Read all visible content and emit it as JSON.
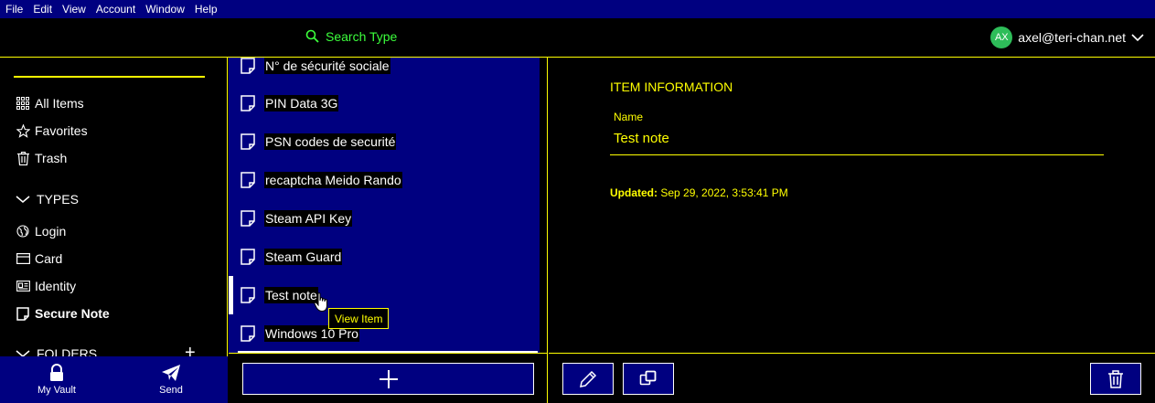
{
  "menu": [
    "File",
    "Edit",
    "View",
    "Account",
    "Window",
    "Help"
  ],
  "header": {
    "search_label": "Search Type",
    "avatar_initials": "AX",
    "email": "axel@teri-chan.net"
  },
  "sidebar": {
    "items": [
      {
        "label": "All Items",
        "icon": "grid-icon"
      },
      {
        "label": "Favorites",
        "icon": "star-icon"
      },
      {
        "label": "Trash",
        "icon": "trash-icon"
      }
    ],
    "types_header": "TYPES",
    "types": [
      {
        "label": "Login",
        "icon": "globe-icon"
      },
      {
        "label": "Card",
        "icon": "credit-card-icon"
      },
      {
        "label": "Identity",
        "icon": "id-card-icon"
      },
      {
        "label": "Secure Note",
        "icon": "sticky-note-icon",
        "selected": true
      }
    ],
    "folders_header": "FOLDERS"
  },
  "bottom_nav": {
    "vault": "My Vault",
    "send": "Send"
  },
  "list": {
    "items": [
      "N° de sécurité sociale",
      "PIN Data 3G",
      "PSN codes de securité",
      "recaptcha Meido Rando",
      "Steam API Key",
      "Steam Guard",
      "Test note",
      "Windows 10 Pro"
    ],
    "active_index": 6,
    "tooltip": "View Item"
  },
  "detail": {
    "section_title": "ITEM INFORMATION",
    "name_label": "Name",
    "name_value": "Test note",
    "updated_label": "Updated:",
    "updated_value": "Sep 29, 2022, 3:53:41 PM"
  },
  "colors": {
    "accent": "#ffff00",
    "navy": "#000080",
    "search_green": "#3cff3c",
    "avatar_green": "#2ebd59"
  }
}
